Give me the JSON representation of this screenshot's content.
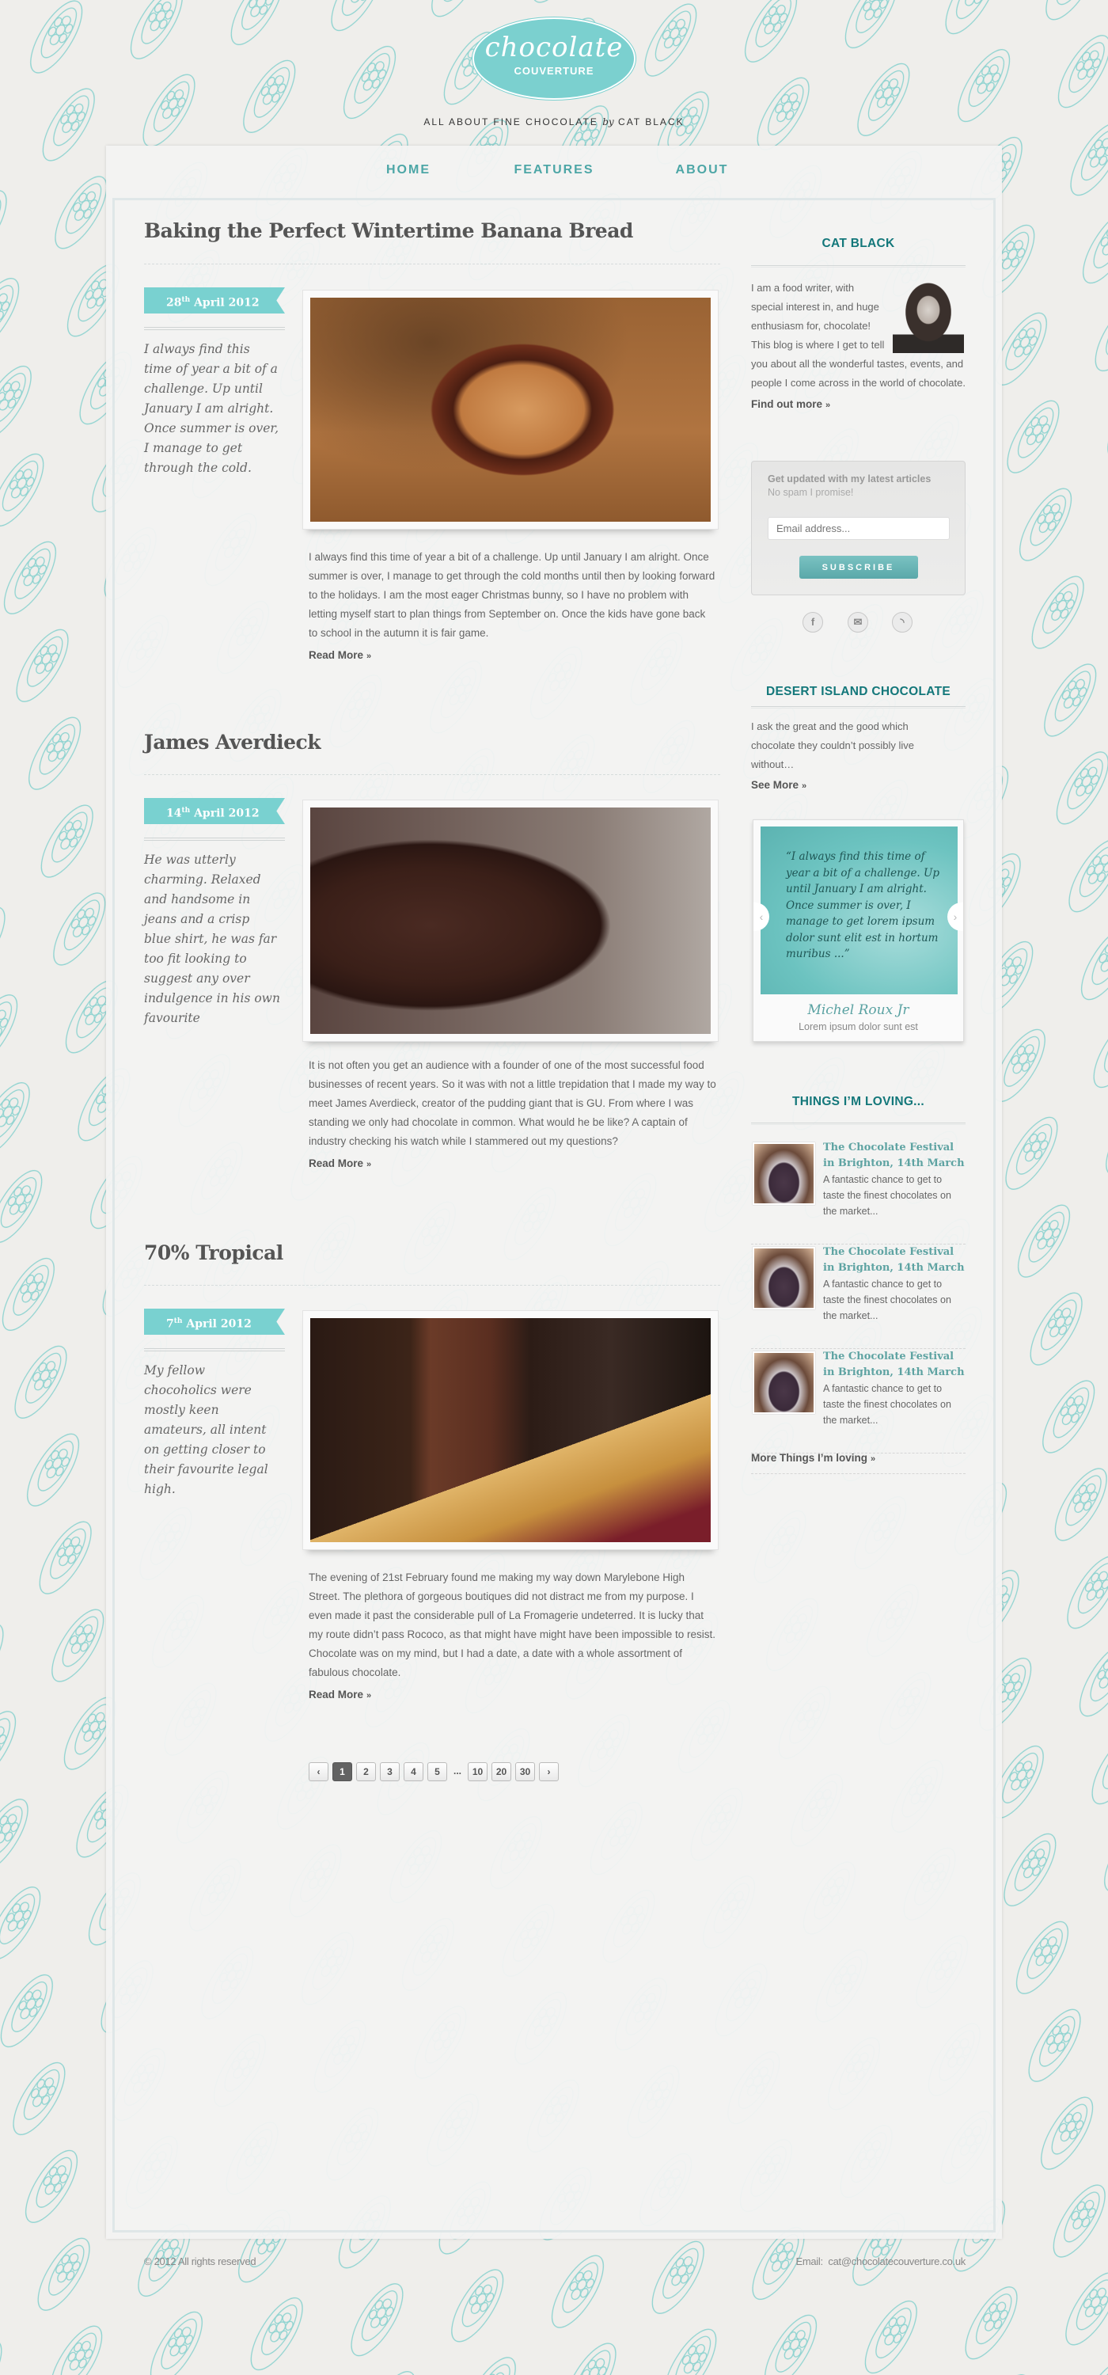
{
  "brand": {
    "logo_script": "chocolate",
    "logo_sub": "COUVERTURE",
    "tagline_pre": "ALL ABOUT FINE CHOCOLATE",
    "tagline_by": "by",
    "tagline_post": "CAT BLACK",
    "accent": "#79d1d0",
    "heading_color": "#13777a"
  },
  "nav": [
    "HOME",
    "FEATURES",
    "ABOUT"
  ],
  "posts": [
    {
      "title": "Baking the Perfect Wintertime Banana Bread",
      "day": "28",
      "suffix": "th",
      "month_year": "April 2012",
      "excerpt": "I always find this time of year a bit of a challenge. Up until January I am alright. Once summer is over, I manage to get through the cold.",
      "body": "I always find this time of year a bit of a challenge. Up until January I am alright. Once summer is over, I manage to get through the cold months until then by looking forward to the holidays. I am the most eager Christmas bunny, so I have no problem with letting myself start to plan things from September on. Once the kids have gone back to school in the autumn it is fair game.",
      "read_more": "Read More",
      "chev": "»"
    },
    {
      "title": "James Averdieck",
      "day": "14",
      "suffix": "th",
      "month_year": "April 2012",
      "excerpt": "He was utterly charming. Relaxed and handsome in jeans and a crisp blue shirt, he was far too fit looking to suggest any over indulgence in his own favourite",
      "body": "It is not often you get an audience with a founder of one of the most successful food businesses of recent years. So it was with not a little trepidation that I made my way to meet James Averdieck, creator of the pudding giant that is GU. From where I was standing we only had chocolate in common. What would he be like? A captain of industry checking his watch while I stammered out my questions?",
      "read_more": "Read More",
      "chev": "»"
    },
    {
      "title": "70% Tropical",
      "day": "7",
      "suffix": "th",
      "month_year": "April 2012",
      "excerpt": "My fellow chocoholics were mostly keen amateurs, all intent on getting closer to their favourite legal high.",
      "body": "The evening of 21st February found me making my way down Marylebone High Street. The plethora of gorgeous boutiques did not distract me from my purpose. I even made it past the considerable pull of La Fromagerie undeterred. It is lucky that my route didn’t pass Rococo, as that might have might have been impossible to resist. Chocolate was on my mind, but I had a date, a date with a whole assortment of fabulous chocolate.",
      "read_more": "Read More",
      "chev": "»"
    }
  ],
  "pagination": {
    "prev": "‹",
    "pages": [
      "1",
      "2",
      "3",
      "4",
      "5"
    ],
    "ellipsis": "...",
    "far": [
      "10",
      "20",
      "30"
    ],
    "next": "›",
    "current": "1"
  },
  "sidebar": {
    "about": {
      "heading": "CAT BLACK",
      "text": "I am a food writer, with special interest in, and huge enthusiasm for, chocolate! This blog is where I get to tell you about all the wonderful tastes, events, and people I come across in the world of chocolate.",
      "link": "Find out more",
      "chev": "»"
    },
    "subscribe": {
      "title": "Get updated with my latest articles",
      "note": "No spam I promise!",
      "placeholder": "Email address...",
      "button": "SUBSCRIBE"
    },
    "social": [
      {
        "icon": "facebook-icon",
        "glyph": "f"
      },
      {
        "icon": "mail-icon",
        "glyph": "✉"
      },
      {
        "icon": "rss-icon",
        "glyph": "◝"
      }
    ],
    "desert": {
      "heading": "DESERT ISLAND CHOCOLATE",
      "text": "I ask the great and the good which chocolate they couldn’t possibly live without…",
      "link": "See More",
      "chev": "»",
      "quote": "“I always find this time of year a bit of a challenge. Up until January I am alright. Once summer is over, I manage to get lorem ipsum dolor sunt elit est in hortum muribus ...”",
      "name": "Michel Roux Jr",
      "sub": "Lorem ipsum dolor sunt est",
      "prev": "‹",
      "next": "›"
    },
    "loving": {
      "heading": "THINGS I’M LOVING...",
      "items": [
        {
          "title": "The Chocolate Festival in Brighton, 14th March",
          "desc": "A fantastic chance to get to taste the finest chocolates on the market..."
        },
        {
          "title": "The Chocolate Festival in Brighton, 14th March",
          "desc": "A fantastic chance to get to taste the finest chocolates on the market..."
        },
        {
          "title": "The Chocolate Festival in Brighton, 14th March",
          "desc": "A fantastic chance to get to taste the finest chocolates on the market..."
        }
      ],
      "link": "More Things I’m loving",
      "chev": "»"
    }
  },
  "footer": {
    "copyright": "© 2012 All rights reserved",
    "email_label": "Email:",
    "email": "cat@chocolatecouverture.co.uk"
  }
}
